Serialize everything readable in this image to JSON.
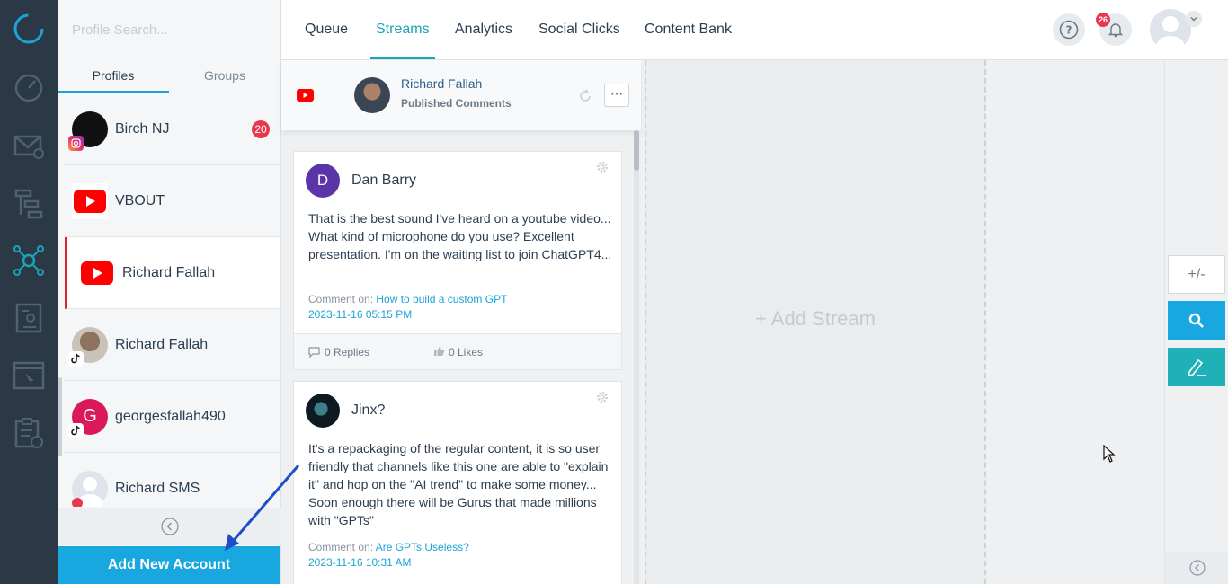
{
  "sidebar_icons": [
    "speedometer-icon",
    "mail-icon",
    "flow-icon",
    "network-icon",
    "document-icon",
    "browser-icon",
    "clipboard-icon"
  ],
  "profiles": {
    "search_placeholder": "Profile Search...",
    "tabs": [
      "Profiles",
      "Groups"
    ],
    "items": [
      {
        "name": "Birch NJ",
        "network": "instagram",
        "badge": "20"
      },
      {
        "name": "VBOUT",
        "network": "youtube"
      },
      {
        "name": "Richard Fallah",
        "network": "youtube"
      },
      {
        "name": "Richard Fallah",
        "network": "tiktok"
      },
      {
        "name": "georgesfallah490",
        "network": "tiktok",
        "initial": "G"
      },
      {
        "name": "Richard SMS",
        "network": "sms"
      }
    ],
    "add_account_label": "Add New Account"
  },
  "nav": {
    "tabs": [
      "Queue",
      "Streams",
      "Analytics",
      "Social Clicks",
      "Content Bank"
    ],
    "active_tab": "Streams",
    "notification_count": "26"
  },
  "stream": {
    "owner": "Richard Fallah",
    "type": "Published Comments",
    "comments": [
      {
        "author": "Dan Barry",
        "initial": "D",
        "text": "That is the best sound I've heard on a youtube video... What kind of microphone do you use? Excellent presentation. I'm on the waiting list to join ChatGPT4...",
        "comment_on_label": "Comment on:",
        "comment_on_link": "How to build a custom GPT",
        "date": "2023-11-16 05:15 PM",
        "replies": "0 Replies",
        "likes": "0 Likes"
      },
      {
        "author": "Jinx?",
        "text": "It's a repackaging of the regular content, it is so user friendly that channels like this one are able to \"explain it\" and hop on the \"AI trend\" to make some money... Soon enough there will be Gurus that made millions with \"GPTs\"",
        "comment_on_label": "Comment on:",
        "comment_on_link": "Are GPTs Useless?",
        "date": "2023-11-16 10:31 AM"
      }
    ]
  },
  "add_stream_label": "+ Add Stream",
  "toolbar": {
    "plusminus": "+/-"
  },
  "colors": {
    "accent": "#1ba3b6",
    "blue": "#19a7e0",
    "badge": "#e8384f",
    "rail": "#2b3846"
  }
}
